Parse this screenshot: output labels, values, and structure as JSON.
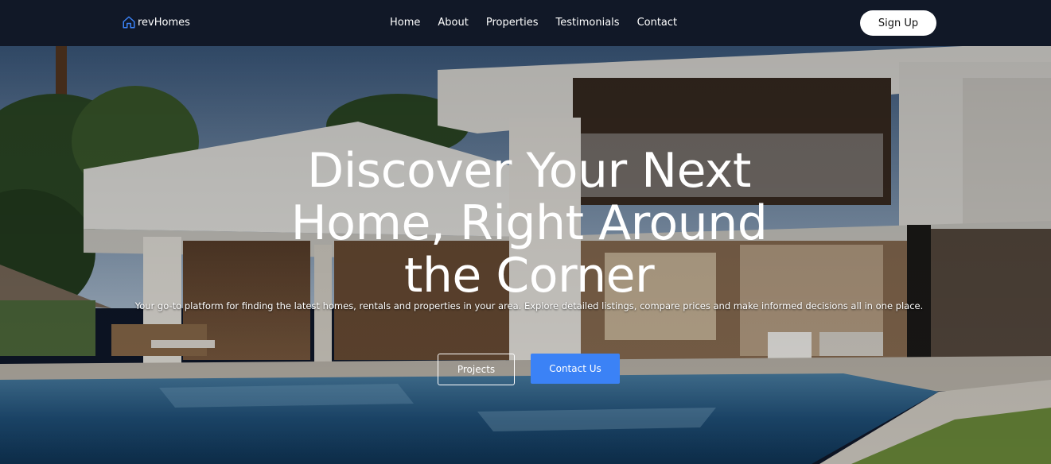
{
  "brand": {
    "name": "revHomes",
    "icon": "house-icon",
    "icon_color": "#3b82f6"
  },
  "nav": {
    "items": [
      {
        "label": "Home"
      },
      {
        "label": "About"
      },
      {
        "label": "Properties"
      },
      {
        "label": "Testimonials"
      },
      {
        "label": "Contact"
      }
    ],
    "signup_label": "Sign Up"
  },
  "hero": {
    "title": "Discover Your Next Home, Right Around the Corner",
    "subtitle": "Your go-to platform for finding the latest homes, rentals and properties in your area. Explore detailed listings, compare prices and make informed decisions all in one place.",
    "primary_button": "Contact Us",
    "secondary_button": "Projects"
  },
  "colors": {
    "nav_bg": "#111827",
    "accent": "#3b82f6",
    "button_text": "#ffffff"
  }
}
